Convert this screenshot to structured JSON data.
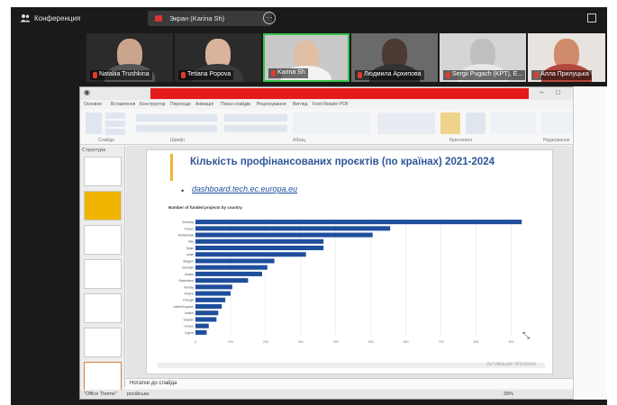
{
  "zoom": {
    "meeting_label": "Конференция",
    "share_label": "Экран (Karina Sh)",
    "more_label": "···"
  },
  "participants": [
    {
      "name": "Nataliia Trushkina"
    },
    {
      "name": "Tetiana Popova"
    },
    {
      "name": "Karina Sh"
    },
    {
      "name": "Людмила Архипова"
    },
    {
      "name": "Sergii Pugach (KPT), E..."
    },
    {
      "name": "Алла Прилуцька"
    }
  ],
  "ppt": {
    "tabs": [
      "Основне",
      "Вставлення",
      "Конструктор",
      "Переходи",
      "Анімація",
      "Показ слайдів",
      "Рецензування",
      "Вигляд",
      "Foxit Reader PDF"
    ],
    "group_labels": [
      "Слайди",
      "Шрифт",
      "Абзац",
      "Креслення",
      "Редагування"
    ],
    "sidepane_label": "Структура",
    "notes_label": "Нотатки до слайда",
    "status_left": "\"Office Theme\"",
    "status_lang": "російська",
    "zoom_level": "39%",
    "activation_text": "Активация Windows"
  },
  "slide": {
    "title": "Кількість профінансованих проєктів (по країнах) 2021-2024",
    "link": "dashboard.tech.ec.europa.eu"
  },
  "chart_data": {
    "type": "bar",
    "orientation": "horizontal",
    "title": "Number of funded projects by country",
    "categories": [
      "Germany",
      "France",
      "Netherlands",
      "Italy",
      "Spain",
      "Israel",
      "Belgium",
      "Denmark",
      "Austria",
      "Switzerland",
      "Norway",
      "Finland",
      "Portugal",
      "United Kingdom",
      "Ireland",
      "Sweden",
      "Greece",
      "Cyprus"
    ],
    "values": [
      930,
      555,
      505,
      365,
      365,
      315,
      225,
      205,
      190,
      150,
      105,
      100,
      85,
      75,
      65,
      60,
      38,
      32
    ],
    "xlim": [
      0,
      950
    ],
    "xticks": [
      0,
      100,
      200,
      300,
      400,
      500,
      600,
      700,
      800,
      900
    ],
    "bar_color": "#1f4e9c",
    "grid": true
  }
}
